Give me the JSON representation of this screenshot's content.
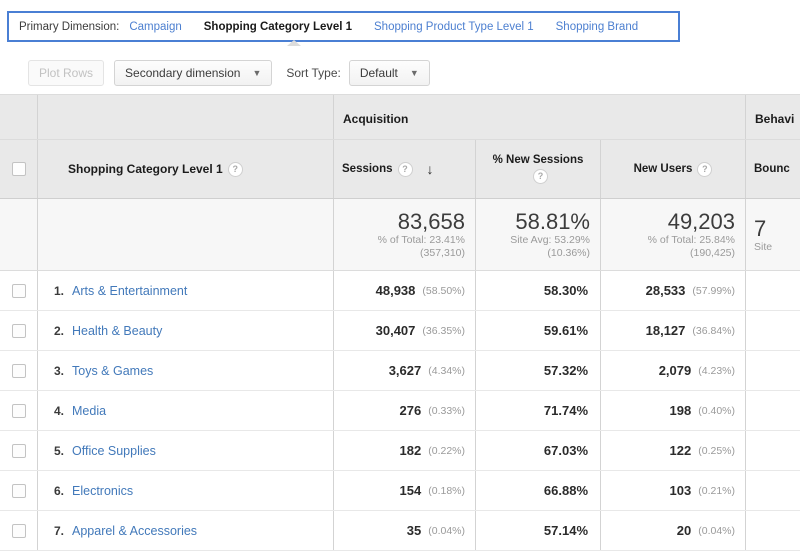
{
  "primary_dimension": {
    "label": "Primary Dimension:",
    "tabs": [
      {
        "label": "Campaign",
        "active": false
      },
      {
        "label": "Shopping Category Level 1",
        "active": true
      },
      {
        "label": "Shopping Product Type Level 1",
        "active": false
      },
      {
        "label": "Shopping Brand",
        "active": false
      }
    ],
    "highlight_color": "#4a7fd4",
    "link_color": "#4c7fd0"
  },
  "toolbar": {
    "plot_rows_label": "Plot Rows",
    "secondary_dimension_label": "Secondary dimension",
    "sort_type_label": "Sort Type:",
    "sort_type_value": "Default",
    "dropdown_arrow": "▼"
  },
  "table": {
    "group_headers": [
      {
        "label": "Acquisition"
      },
      {
        "label": "Behavi"
      }
    ],
    "dimension_header": "Shopping Category Level 1",
    "help_glyph": "?",
    "sort_arrow": "↓",
    "columns": [
      {
        "label": "Sessions",
        "sorted": true
      },
      {
        "label": "% New Sessions",
        "line1": "% New Sessions",
        "sorted": false
      },
      {
        "label": "New Users",
        "sorted": false
      },
      {
        "label": "Bounc",
        "sorted": false
      }
    ],
    "summary": {
      "sessions": {
        "value": "83,658",
        "sub1": "% of Total: 23.41%",
        "sub2": "(357,310)"
      },
      "new_sessions_pct": {
        "value": "58.81%",
        "sub1": "Site Avg: 53.29%",
        "sub2": "(10.36%)"
      },
      "new_users": {
        "value": "49,203",
        "sub1": "% of Total: 25.84%",
        "sub2": "(190,425)"
      },
      "bounce": {
        "value": "7",
        "sub1": "Site",
        "sub2": ""
      }
    },
    "rows": [
      {
        "rank": "1.",
        "dimension": "Arts & Entertainment",
        "sessions": "48,938",
        "sessions_pct": "(58.50%)",
        "new_sessions_pct": "58.30%",
        "new_users": "28,533",
        "new_users_pct": "(57.99%)"
      },
      {
        "rank": "2.",
        "dimension": "Health & Beauty",
        "sessions": "30,407",
        "sessions_pct": "(36.35%)",
        "new_sessions_pct": "59.61%",
        "new_users": "18,127",
        "new_users_pct": "(36.84%)"
      },
      {
        "rank": "3.",
        "dimension": "Toys & Games",
        "sessions": "3,627",
        "sessions_pct": "(4.34%)",
        "new_sessions_pct": "57.32%",
        "new_users": "2,079",
        "new_users_pct": "(4.23%)"
      },
      {
        "rank": "4.",
        "dimension": "Media",
        "sessions": "276",
        "sessions_pct": "(0.33%)",
        "new_sessions_pct": "71.74%",
        "new_users": "198",
        "new_users_pct": "(0.40%)"
      },
      {
        "rank": "5.",
        "dimension": "Office Supplies",
        "sessions": "182",
        "sessions_pct": "(0.22%)",
        "new_sessions_pct": "67.03%",
        "new_users": "122",
        "new_users_pct": "(0.25%)"
      },
      {
        "rank": "6.",
        "dimension": "Electronics",
        "sessions": "154",
        "sessions_pct": "(0.18%)",
        "new_sessions_pct": "66.88%",
        "new_users": "103",
        "new_users_pct": "(0.21%)"
      },
      {
        "rank": "7.",
        "dimension": "Apparel & Accessories",
        "sessions": "35",
        "sessions_pct": "(0.04%)",
        "new_sessions_pct": "57.14%",
        "new_users": "20",
        "new_users_pct": "(0.04%)"
      }
    ]
  }
}
